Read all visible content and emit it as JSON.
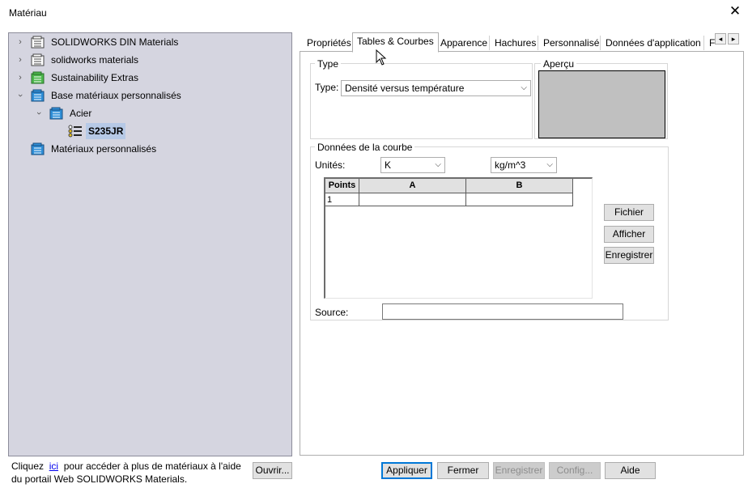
{
  "window": {
    "title": "Matériau",
    "close_glyph": "✕"
  },
  "tree": {
    "items": [
      {
        "label": "SOLIDWORKS DIN Materials",
        "expanded": false,
        "icon": "library-icon",
        "icon_color": "#ffffff"
      },
      {
        "label": "solidworks materials",
        "expanded": false,
        "icon": "library-icon",
        "icon_color": "#ffffff"
      },
      {
        "label": "Sustainability Extras",
        "expanded": false,
        "icon": "library-green-icon",
        "icon_color": "#4cb84c"
      },
      {
        "label": "Base matériaux personnalisés",
        "expanded": true,
        "icon": "library-blue-icon",
        "icon_color": "#2f8fd8"
      },
      {
        "label": "Acier",
        "expanded": true,
        "icon": "category-icon",
        "icon_color": "#2f8fd8"
      },
      {
        "label": "S235JR",
        "selected": true,
        "icon": "material-icon"
      },
      {
        "label": "Matériaux personnalisés",
        "icon": "library-blue-icon",
        "icon_color": "#2f8fd8"
      }
    ]
  },
  "tabs": [
    {
      "label": "Propriétés"
    },
    {
      "label": "Tables & Courbes",
      "active": true
    },
    {
      "label": "Apparence"
    },
    {
      "label": "Hachures"
    },
    {
      "label": "Personnalisé"
    },
    {
      "label": "Données d'application"
    },
    {
      "label": "F"
    }
  ],
  "tab_scroll": {
    "left": "◂",
    "right": "▸"
  },
  "type_group": {
    "title": "Type",
    "type_label": "Type:",
    "type_value": "Densité versus température"
  },
  "preview_group": {
    "title": "Aperçu",
    "fill_color": "#c0c0c0"
  },
  "curve_group": {
    "title": "Données de la courbe",
    "units_label": "Unités:",
    "unit_x": "K",
    "unit_y": "kg/m^3",
    "table": {
      "headers": [
        "Points",
        "A",
        "B"
      ],
      "rows": [
        [
          "1",
          "",
          ""
        ]
      ]
    },
    "buttons": {
      "file": "Fichier",
      "show": "Afficher",
      "save": "Enregistrer"
    },
    "source_label": "Source:",
    "source_value": ""
  },
  "footer": {
    "text_before": "Cliquez",
    "link": "ici",
    "text_after": "pour accéder à plus de matériaux à l'aide du portail Web SOLIDWORKS Materials.",
    "open_button": "Ouvrir..."
  },
  "actions": {
    "apply": "Appliquer",
    "close": "Fermer",
    "save": "Enregistrer",
    "config": "Config...",
    "help": "Aide"
  },
  "colors": {
    "tree_bg": "#d5d5e0",
    "selection": "#b6c9e6",
    "focus_border": "#0078d7"
  }
}
